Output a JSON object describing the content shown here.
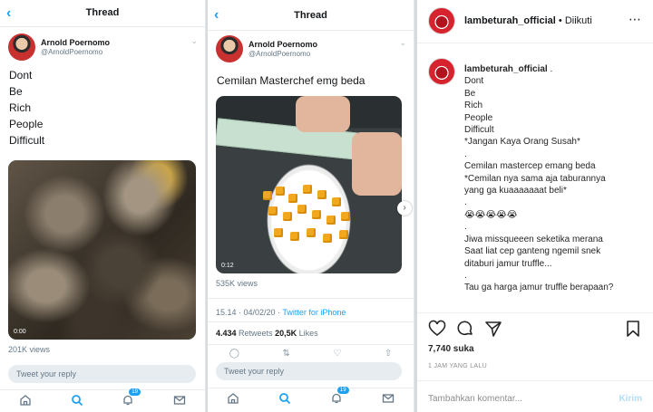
{
  "panel1": {
    "header_title": "Thread",
    "author_name": "Arnold Poernomo",
    "author_handle": "@ArnoldPoernomo",
    "tweet_lines": [
      "Dont",
      "Be",
      "Rich",
      "People",
      "Difficult"
    ],
    "video_time": "0:00",
    "views": "201K views",
    "reply_placeholder": "Tweet your reply",
    "notification_count": "19"
  },
  "panel2": {
    "header_title": "Thread",
    "author_name": "Arnold Poernomo",
    "author_handle": "@ArnoldPoernomo",
    "tweet_text": "Cemilan Masterchef emg beda",
    "video_time": "0:12",
    "views": "535K views",
    "timestamp": "15.14 · 04/02/20 · ",
    "source": "Twitter for iPhone",
    "retweets_count": "4.434",
    "retweets_label": " Retweets  ",
    "likes_count": "20,5K",
    "likes_label": " Likes",
    "reply_placeholder": "Tweet your reply",
    "notification_count": "19"
  },
  "instagram": {
    "username": "lambeturah_official",
    "follow_status": " • Diikuti",
    "caption_user": "lambeturah_official",
    "caption_lines": [
      " .",
      "Dont",
      "Be",
      "Rich",
      "People",
      "Difficult",
      "*Jangan Kaya Orang Susah*",
      ".",
      "Cemilan mastercep emang beda",
      "*Cemilan nya sama aja taburannya",
      "yang ga kuaaaaaaat beli*",
      ".",
      "😭😭😭😭😭",
      ".",
      "Jiwa missqueeen seketika merana",
      "Saat liat cep ganteng ngemil snek",
      "ditaburi jamur truffle...",
      ".",
      "Tau ga harga jamur truffle berapaan?"
    ],
    "likes": "7,740 suka",
    "time_ago": "1 JAM YANG LALU",
    "comment_placeholder": "Tambahkan komentar...",
    "send_label": "Kirim"
  },
  "colors": {
    "twitter_blue": "#1da1f2",
    "ig_send_disabled": "#b2dffc"
  }
}
